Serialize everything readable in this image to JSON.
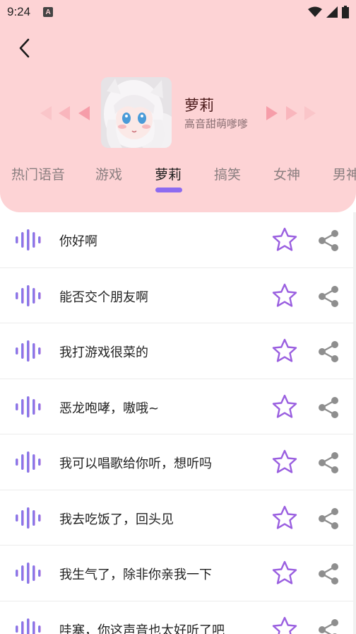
{
  "status_bar": {
    "time": "9:24",
    "notification_icon": "A"
  },
  "header": {
    "back_icon": "chevron-left",
    "character_name": "萝莉",
    "character_desc": "高音甜萌嗲嗲"
  },
  "tabs": [
    {
      "label": "热门语音",
      "active": false
    },
    {
      "label": "游戏",
      "active": false
    },
    {
      "label": "萝莉",
      "active": true
    },
    {
      "label": "搞笑",
      "active": false
    },
    {
      "label": "女神",
      "active": false
    },
    {
      "label": "男神",
      "active": false
    }
  ],
  "items": [
    {
      "text": "你好啊"
    },
    {
      "text": "能否交个朋友啊"
    },
    {
      "text": "我打游戏很菜的"
    },
    {
      "text": "恶龙咆哮，嗷哦~"
    },
    {
      "text": "我可以唱歌给你听，想听吗"
    },
    {
      "text": "我去吃饭了，回头见"
    },
    {
      "text": "我生气了，除非你亲我一下"
    },
    {
      "text": "哇塞，你这声音也太好听了吧"
    }
  ],
  "colors": {
    "header_bg": "#fdd3d5",
    "accent": "#8d6bf0",
    "arrow": "#f59aa6"
  }
}
